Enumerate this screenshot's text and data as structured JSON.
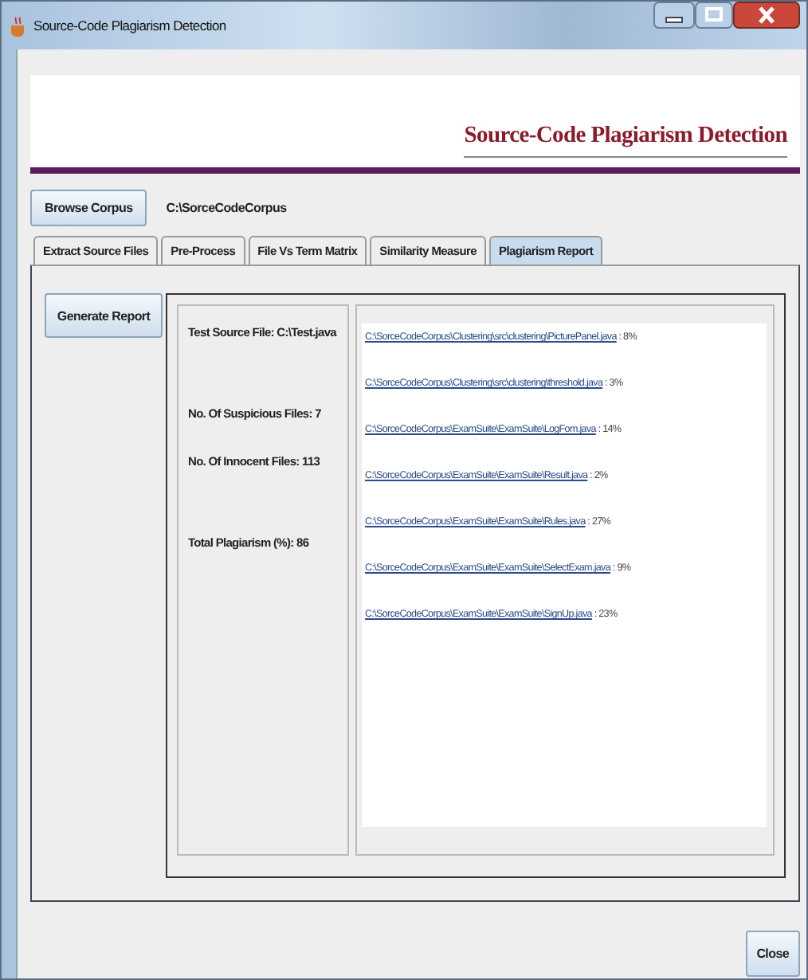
{
  "window": {
    "title": "Source-Code Plagiarism Detection"
  },
  "header": {
    "title": "Source-Code Plagiarism Detection"
  },
  "corpus": {
    "button": "Browse Corpus",
    "path": "C:\\SorceCodeCorpus"
  },
  "tabs": [
    {
      "label": "Extract Source Files",
      "selected": false
    },
    {
      "label": "Pre-Process",
      "selected": false
    },
    {
      "label": "File Vs Term Matrix",
      "selected": false
    },
    {
      "label": "Similarity Measure",
      "selected": false
    },
    {
      "label": "Plagiarism Report",
      "selected": true
    }
  ],
  "report": {
    "button": "Generate Report",
    "summary": [
      "Test Source File: C:\\Test.java",
      "No. Of Suspicious Files: 7",
      "No. Of Innocent Files: 113",
      "Total Plagiarism (%): 86"
    ],
    "files": [
      {
        "path": "C:\\SorceCodeCorpus\\Clustering\\src\\clustering\\PicturePanel.java",
        "score": " : 8%"
      },
      {
        "path": "C:\\SorceCodeCorpus\\Clustering\\src\\clustering\\threshold.java",
        "score": " : 3%"
      },
      {
        "path": "C:\\SorceCodeCorpus\\ExamSuite\\ExamSuite\\LogFom.java",
        "score": " : 14%"
      },
      {
        "path": "C:\\SorceCodeCorpus\\ExamSuite\\ExamSuite\\Result.java",
        "score": " : 2%"
      },
      {
        "path": "C:\\SorceCodeCorpus\\ExamSuite\\ExamSuite\\Rules.java",
        "score": " : 27%"
      },
      {
        "path": "C:\\SorceCodeCorpus\\ExamSuite\\ExamSuite\\SelectExam.java",
        "score": " : 9%"
      },
      {
        "path": "C:\\SorceCodeCorpus\\ExamSuite\\ExamSuite\\SignUp.java",
        "score": " : 23%"
      }
    ]
  },
  "buttons": [
    "Close"
  ]
}
